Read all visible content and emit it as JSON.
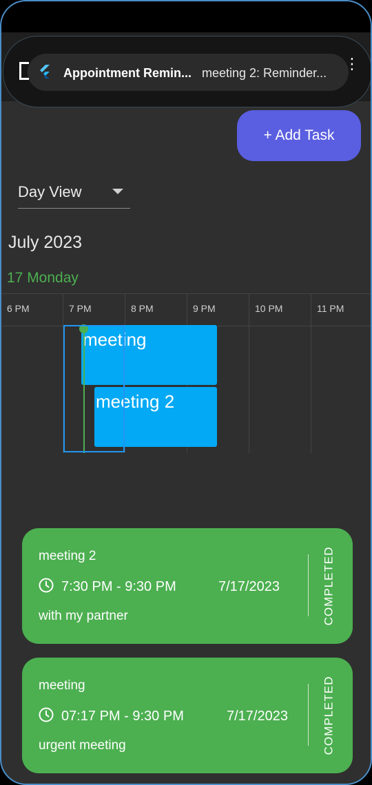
{
  "notification": {
    "app_name": "Appointment Remin...",
    "text": "meeting 2: Reminder..."
  },
  "toolbar": {
    "add_task_label": "+ Add Task"
  },
  "view_selector": {
    "selected": "Day View"
  },
  "calendar": {
    "month_title": "July 2023",
    "day_label": "17 Monday",
    "hours": [
      "6 PM",
      "7 PM",
      "8 PM",
      "9 PM",
      "10 PM",
      "11 PM"
    ],
    "events": [
      {
        "title": "meeting"
      },
      {
        "title": "meeting 2"
      }
    ]
  },
  "tasks": [
    {
      "title": "meeting 2",
      "time": "7:30 PM - 9:30 PM",
      "date": "7/17/2023",
      "description": "with my partner",
      "status": "COMPLETED"
    },
    {
      "title": "meeting",
      "time": "07:17 PM - 9:30 PM",
      "date": "7/17/2023",
      "description": "urgent meeting",
      "status": "COMPLETED"
    }
  ],
  "colors": {
    "accent": "#5a5ee0",
    "event": "#03a9f4",
    "completed": "#4caf50",
    "background": "#2f2f2f"
  }
}
